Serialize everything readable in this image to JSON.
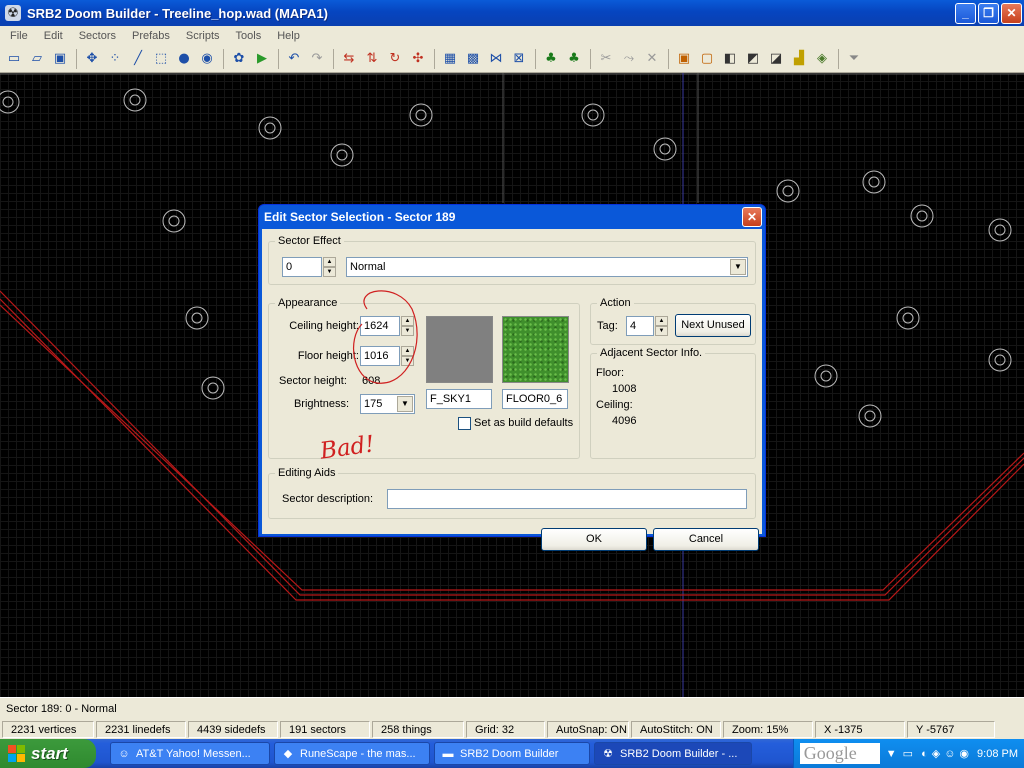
{
  "window": {
    "title": "SRB2 Doom Builder - Treeline_hop.wad (MAPA1)"
  },
  "menu": [
    "File",
    "Edit",
    "Sectors",
    "Prefabs",
    "Scripts",
    "Tools",
    "Help"
  ],
  "dialog": {
    "title": "Edit Sector Selection - Sector 189",
    "sector_effect": {
      "legend": "Sector Effect",
      "value": "0",
      "effect": "Normal"
    },
    "appearance": {
      "legend": "Appearance",
      "ceiling_label": "Ceiling height:",
      "ceiling_value": "1624",
      "floor_label": "Floor height:",
      "floor_value": "1016",
      "sector_height_label": "Sector height:",
      "sector_height_value": "608",
      "brightness_label": "Brightness:",
      "brightness_value": "175",
      "ceiling_texture": "F_SKY1",
      "floor_texture": "FLOOR0_6",
      "ceiling_color": "#808080",
      "floor_color": "#3f8f2c",
      "build_defaults_label": "Set as build defaults"
    },
    "annotation": "Bad!",
    "action": {
      "legend": "Action",
      "tag_label": "Tag:",
      "tag_value": "4",
      "next_unused_label": "Next Unused"
    },
    "adjacent": {
      "legend": "Adjacent Sector Info.",
      "floor_label": "Floor:",
      "floor_value": "1008",
      "ceiling_label": "Ceiling:",
      "ceiling_value": "4096"
    },
    "editing_aids": {
      "legend": "Editing Aids",
      "description_label": "Sector description:",
      "description_value": ""
    },
    "ok_label": "OK",
    "cancel_label": "Cancel"
  },
  "status_line": "Sector 189:  0 - Normal",
  "status": {
    "vertices": "2231 vertices",
    "linedefs": "2231 linedefs",
    "sidedefs": "4439 sidedefs",
    "sectors": "191 sectors",
    "things": "258 things",
    "grid": "Grid: 32",
    "autosnap": "AutoSnap: ON",
    "autostitch": "AutoStitch: ON",
    "zoom": "Zoom: 15%",
    "x": "X -1375",
    "y": "Y -5767"
  },
  "taskbar": {
    "start_label": "start",
    "tasks": [
      "AT&T Yahoo! Messen...",
      "RuneScape - the mas...",
      "SRB2 Doom Builder",
      "SRB2 Doom Builder - ..."
    ],
    "search_brand": "Google",
    "clock": "9:08 PM"
  }
}
